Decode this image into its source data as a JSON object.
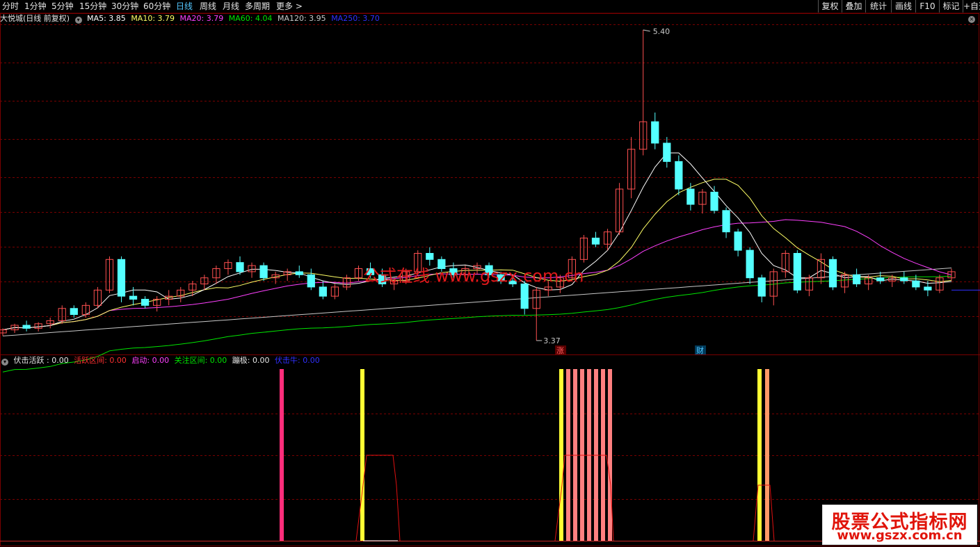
{
  "toolbar": {
    "tabs": [
      "分时",
      "1分钟",
      "5分钟",
      "15分钟",
      "30分钟",
      "60分钟",
      "日线",
      "周线",
      "月线",
      "多周期",
      "更多 >"
    ],
    "active_tab": "日线",
    "right_buttons": [
      "复权",
      "叠加",
      "统计",
      "画线",
      "F10",
      "标记",
      "+自选"
    ]
  },
  "main_legend": {
    "title": "大悦城(日线 前复权)",
    "ma5": "MA5: 3.85",
    "ma10": "MA10: 3.79",
    "ma20": "MA20: 3.79",
    "ma60": "MA60: 4.04",
    "ma120": "MA120: 3.95",
    "ma250": "MA250: 3.70"
  },
  "markers": {
    "high_label": "5.40",
    "low_label": "3.37",
    "zhang": "涨",
    "cai": "财"
  },
  "watermark_center": "公式在线 www.gszx.com.cn",
  "sub_legend": {
    "name": "伏击活跃 : 0.00",
    "active_zone": "活跃区间: 0.00",
    "start": "启动: 0.00",
    "focus_zone": "关注区间: 0.00",
    "lurk": "蹦极: 0.00",
    "ambush_bull": "伏击牛: 0.00"
  },
  "watermark_box": {
    "line1": "股票公式指标网",
    "line2": "www.gszx.com.cn"
  },
  "colors": {
    "up": "#ff5050",
    "down": "#54ffff",
    "ma5": "#ffffff",
    "ma10": "#ffff66",
    "ma20": "#ff40ff",
    "ma60": "#00e600",
    "ma120": "#c8c8c8",
    "ma250": "#3030ff",
    "grid": "#7a0000",
    "active_tab": "#54c7ff"
  },
  "chart_data": {
    "type": "candlestick",
    "price_range": [
      3.37,
      5.4
    ],
    "ohlc_estimated": [
      [
        3.42,
        3.45,
        3.4,
        3.44
      ],
      [
        3.44,
        3.48,
        3.42,
        3.47
      ],
      [
        3.47,
        3.5,
        3.43,
        3.45
      ],
      [
        3.45,
        3.49,
        3.43,
        3.48
      ],
      [
        3.48,
        3.52,
        3.45,
        3.5
      ],
      [
        3.5,
        3.6,
        3.48,
        3.58
      ],
      [
        3.58,
        3.6,
        3.52,
        3.54
      ],
      [
        3.54,
        3.62,
        3.52,
        3.6
      ],
      [
        3.6,
        3.72,
        3.58,
        3.7
      ],
      [
        3.7,
        3.92,
        3.68,
        3.9
      ],
      [
        3.9,
        3.92,
        3.62,
        3.66
      ],
      [
        3.66,
        3.72,
        3.6,
        3.64
      ],
      [
        3.64,
        3.66,
        3.58,
        3.6
      ],
      [
        3.6,
        3.66,
        3.56,
        3.64
      ],
      [
        3.64,
        3.7,
        3.6,
        3.66
      ],
      [
        3.66,
        3.72,
        3.62,
        3.7
      ],
      [
        3.7,
        3.76,
        3.66,
        3.74
      ],
      [
        3.74,
        3.8,
        3.7,
        3.78
      ],
      [
        3.78,
        3.86,
        3.74,
        3.84
      ],
      [
        3.84,
        3.9,
        3.8,
        3.88
      ],
      [
        3.88,
        3.92,
        3.8,
        3.82
      ],
      [
        3.82,
        3.88,
        3.78,
        3.86
      ],
      [
        3.86,
        3.88,
        3.76,
        3.78
      ],
      [
        3.78,
        3.82,
        3.74,
        3.8
      ],
      [
        3.8,
        3.84,
        3.76,
        3.82
      ],
      [
        3.82,
        3.86,
        3.78,
        3.8
      ],
      [
        3.8,
        3.84,
        3.7,
        3.72
      ],
      [
        3.72,
        3.76,
        3.64,
        3.66
      ],
      [
        3.66,
        3.74,
        3.64,
        3.72
      ],
      [
        3.72,
        3.8,
        3.7,
        3.78
      ],
      [
        3.78,
        3.86,
        3.76,
        3.84
      ],
      [
        3.84,
        3.88,
        3.78,
        3.8
      ],
      [
        3.8,
        3.84,
        3.72,
        3.74
      ],
      [
        3.74,
        3.78,
        3.7,
        3.76
      ],
      [
        3.76,
        3.84,
        3.74,
        3.82
      ],
      [
        3.82,
        3.96,
        3.8,
        3.94
      ],
      [
        3.94,
        3.98,
        3.86,
        3.9
      ],
      [
        3.9,
        3.92,
        3.82,
        3.84
      ],
      [
        3.84,
        3.88,
        3.78,
        3.8
      ],
      [
        3.8,
        3.86,
        3.76,
        3.84
      ],
      [
        3.84,
        3.88,
        3.8,
        3.86
      ],
      [
        3.86,
        3.88,
        3.78,
        3.8
      ],
      [
        3.8,
        3.82,
        3.74,
        3.76
      ],
      [
        3.76,
        3.78,
        3.72,
        3.74
      ],
      [
        3.74,
        3.76,
        3.54,
        3.58
      ],
      [
        3.58,
        3.72,
        3.37,
        3.7
      ],
      [
        3.7,
        3.76,
        3.66,
        3.72
      ],
      [
        3.72,
        3.8,
        3.68,
        3.78
      ],
      [
        3.78,
        3.92,
        3.76,
        3.9
      ],
      [
        3.9,
        4.06,
        3.88,
        4.04
      ],
      [
        4.04,
        4.08,
        3.98,
        4.0
      ],
      [
        4.0,
        4.1,
        3.96,
        4.08
      ],
      [
        4.08,
        4.4,
        4.06,
        4.36
      ],
      [
        4.36,
        4.7,
        4.3,
        4.62
      ],
      [
        4.62,
        5.4,
        4.58,
        4.8
      ],
      [
        4.8,
        4.86,
        4.62,
        4.66
      ],
      [
        4.66,
        4.7,
        4.5,
        4.54
      ],
      [
        4.54,
        4.58,
        4.32,
        4.36
      ],
      [
        4.36,
        4.4,
        4.22,
        4.26
      ],
      [
        4.26,
        4.36,
        4.2,
        4.34
      ],
      [
        4.34,
        4.38,
        4.2,
        4.22
      ],
      [
        4.22,
        4.24,
        4.04,
        4.08
      ],
      [
        4.08,
        4.1,
        3.92,
        3.96
      ],
      [
        3.96,
        3.98,
        3.74,
        3.78
      ],
      [
        3.78,
        3.8,
        3.62,
        3.66
      ],
      [
        3.66,
        3.84,
        3.6,
        3.82
      ],
      [
        3.82,
        3.96,
        3.78,
        3.94
      ],
      [
        3.94,
        3.96,
        3.68,
        3.7
      ],
      [
        3.7,
        3.8,
        3.66,
        3.78
      ],
      [
        3.78,
        3.94,
        3.74,
        3.9
      ],
      [
        3.9,
        3.92,
        3.7,
        3.72
      ],
      [
        3.72,
        3.82,
        3.68,
        3.8
      ],
      [
        3.8,
        3.84,
        3.72,
        3.74
      ],
      [
        3.74,
        3.8,
        3.7,
        3.78
      ],
      [
        3.78,
        3.82,
        3.74,
        3.76
      ],
      [
        3.76,
        3.8,
        3.72,
        3.78
      ],
      [
        3.78,
        3.82,
        3.74,
        3.76
      ],
      [
        3.76,
        3.8,
        3.7,
        3.72
      ],
      [
        3.72,
        3.76,
        3.66,
        3.7
      ],
      [
        3.7,
        3.8,
        3.68,
        3.78
      ],
      [
        3.78,
        3.84,
        3.76,
        3.82
      ]
    ],
    "sub_signals": [
      {
        "type": "pink_bar",
        "index": 39
      },
      {
        "type": "yellow_bar",
        "index": 50
      },
      {
        "type": "salmon_bars",
        "start": 79,
        "count": 7
      },
      {
        "type": "yellow_bar",
        "index": 108
      },
      {
        "type": "salmon_bar",
        "index": 109
      }
    ]
  }
}
